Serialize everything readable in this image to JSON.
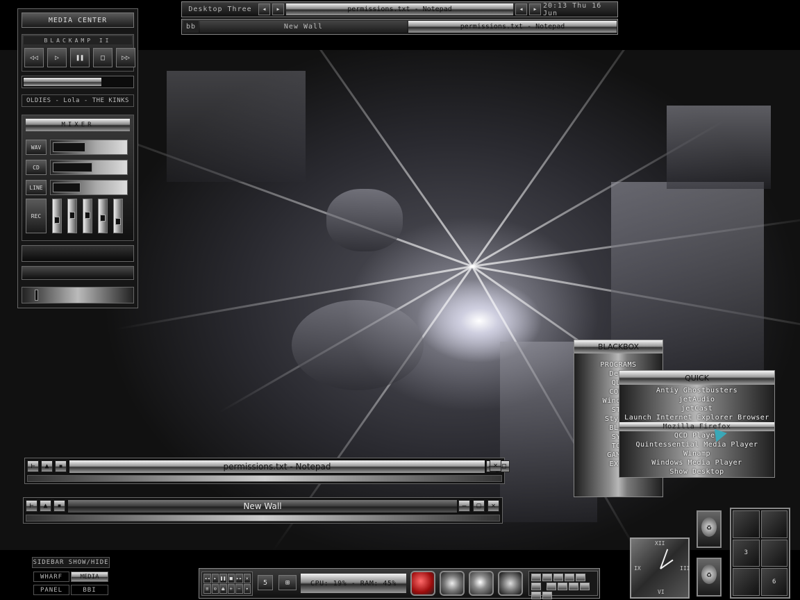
{
  "toolbar": {
    "workspace": "Desktop Three",
    "window_title": "permissions.txt - Notepad",
    "clock": "20:13 Thu 16 Jun",
    "bb_label": "bb",
    "task_new_wall": "New Wall",
    "task_notepad": "permissions.txt - Notepad"
  },
  "media_center": {
    "title": "MEDIA CENTER",
    "player_name": "BLACKAMP II",
    "now_playing": "OLDIES - Lola - THE KINKS",
    "progress": 0.72,
    "mixer_title": "MIXER",
    "channels": [
      {
        "label": "WAV",
        "level": 0.45
      },
      {
        "label": "CD",
        "level": 0.55
      },
      {
        "label": "LINE",
        "level": 0.38
      }
    ],
    "rec_label": "REC",
    "faders": [
      0.3,
      0.5,
      0.5,
      0.4,
      0.25
    ]
  },
  "blackbox_menu": {
    "title": "BLACKBOX",
    "items": [
      "PROGRAMS",
      "Desk",
      "QUI",
      "COMP",
      "Windows",
      "STY",
      "Styles",
      "BLAC",
      "SYS",
      "TOO",
      "GAMES",
      "EXIT"
    ]
  },
  "quick_menu": {
    "title": "QUICK",
    "items": [
      "Antiy Ghostbusters",
      "jetAudio",
      "jetCast",
      "Launch Internet Explorer Browser",
      "Mozilla Firefox",
      "QCD Player",
      "Quintessential Media Player",
      "Winamp",
      "Windows Media Player",
      "Show Desktop"
    ],
    "selected_index": 4
  },
  "windows": [
    {
      "title": "permissions.txt - Notepad"
    },
    {
      "title": "New Wall"
    }
  ],
  "sidebar": {
    "title": "SIDEBAR SHOW/HIDE",
    "buttons": [
      "WHARF",
      "MEDIA",
      "PANEL",
      "BBI"
    ]
  },
  "dock": {
    "workspace_num": "5",
    "cpu_ram": "CPU: 19% - RAM: 45%"
  },
  "pager": {
    "cells": [
      "",
      "",
      "3",
      "",
      "",
      "6"
    ]
  },
  "clock_numerals": [
    "XII",
    "III",
    "VI",
    "IX"
  ]
}
